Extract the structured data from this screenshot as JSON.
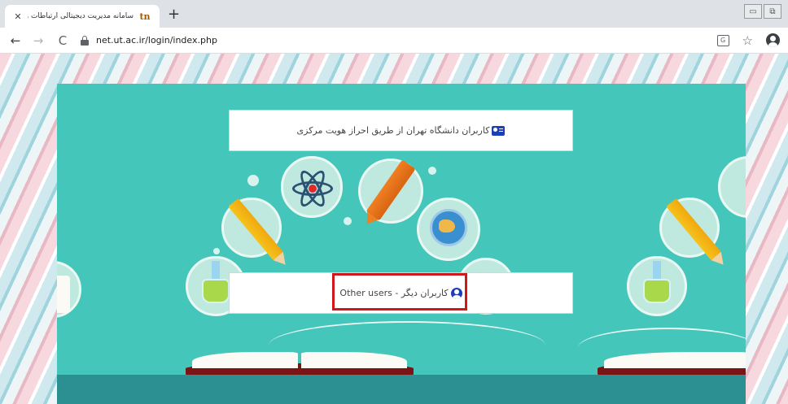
{
  "browser": {
    "tab": {
      "title": "سامانه مدیریت دیجیتالی ارتباطات و مستندات",
      "favicon": "tn",
      "close_glyph": "✕"
    },
    "new_tab_glyph": "+",
    "window_controls": [
      "▭",
      "⧉"
    ],
    "toolbar": {
      "back_glyph": "←",
      "forward_glyph": "→",
      "reload_glyph": "C",
      "url": "net.ut.ac.ir/login/index.php",
      "translate_glyph": "G",
      "star_glyph": "☆"
    }
  },
  "login": {
    "university_sso_label": "کاربران دانشگاه تهران از طریق احراز هویت مرکزی",
    "other_users_label": "کاربران دیگر - Other users"
  },
  "icons": {
    "university_sso": "id-card-icon",
    "other_users": "user-circle-icon"
  },
  "colors": {
    "panel_background": "#45c6bb",
    "icon_blue": "#1b3fb8",
    "highlight_red": "#d0181c"
  }
}
